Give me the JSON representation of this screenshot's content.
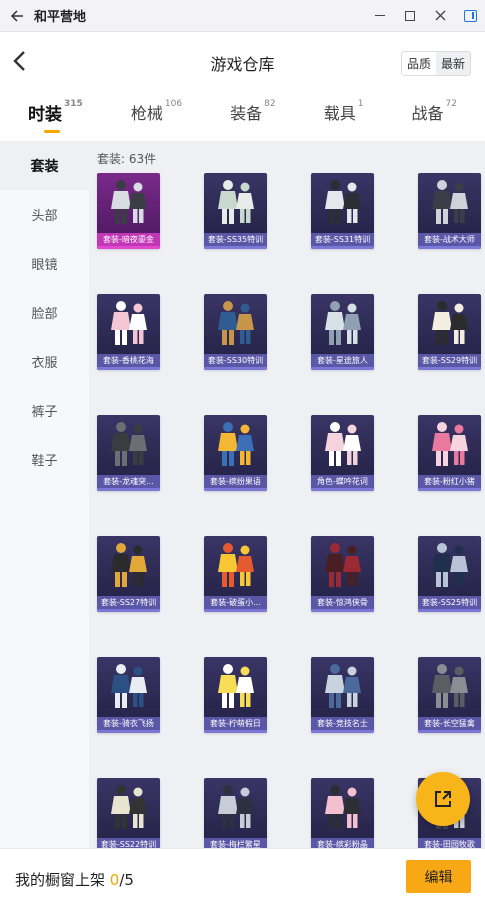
{
  "titlebar": {
    "back_icon": "arrow-left-icon",
    "app_title": "和平营地"
  },
  "header": {
    "title": "游戏仓库",
    "sort_options": [
      "品质",
      "最新"
    ]
  },
  "category_tabs": [
    {
      "label": "时装",
      "count": "315",
      "active": true
    },
    {
      "label": "枪械",
      "count": "106",
      "active": false
    },
    {
      "label": "装备",
      "count": "82",
      "active": false
    },
    {
      "label": "载具",
      "count": "1",
      "active": false
    },
    {
      "label": "战备",
      "count": "72",
      "active": false
    }
  ],
  "sidebar": {
    "items": [
      "套装",
      "头部",
      "眼镜",
      "脸部",
      "衣服",
      "裤子",
      "鞋子"
    ]
  },
  "content": {
    "count_label": "套装: 63件",
    "items": [
      {
        "label": "套装-暗夜鎏金",
        "rarity": "gold"
      },
      {
        "label": "套装-SS35特训",
        "rarity": "purple"
      },
      {
        "label": "套装-SS31特训",
        "rarity": "purple"
      },
      {
        "label": "套装-战术大师",
        "rarity": "purple"
      },
      {
        "label": "套装-香桃花海",
        "rarity": "purple"
      },
      {
        "label": "套装-SS30特训",
        "rarity": "purple"
      },
      {
        "label": "套装-星途旅人",
        "rarity": "purple"
      },
      {
        "label": "套装-SS29特训",
        "rarity": "purple"
      },
      {
        "label": "套装-龙魂突...",
        "rarity": "purple"
      },
      {
        "label": "套装-缤纷果语",
        "rarity": "purple"
      },
      {
        "label": "角色-蝶吟花词",
        "rarity": "purple"
      },
      {
        "label": "套装-粉红小猪",
        "rarity": "purple"
      },
      {
        "label": "套装-SS27特训",
        "rarity": "purple"
      },
      {
        "label": "套装-破蛋小...",
        "rarity": "purple"
      },
      {
        "label": "套装-惊鸿侠骨",
        "rarity": "purple"
      },
      {
        "label": "套装-SS25特训",
        "rarity": "purple"
      },
      {
        "label": "套装-骑衣飞扬",
        "rarity": "purple"
      },
      {
        "label": "套装-柠萌假日",
        "rarity": "purple"
      },
      {
        "label": "套装-竞技名士",
        "rarity": "purple"
      },
      {
        "label": "套装-长空猛禽",
        "rarity": "purple"
      },
      {
        "label": "套装-SS22特训",
        "rarity": "purple"
      },
      {
        "label": "套装-梅栏繁星",
        "rarity": "purple"
      },
      {
        "label": "套装-缤彩粉晶",
        "rarity": "purple"
      },
      {
        "label": "套装-田园牧歌",
        "rarity": "purple"
      }
    ]
  },
  "fab": {
    "icon": "share-external-icon"
  },
  "bottom": {
    "showcase_prefix": "我的橱窗上架 ",
    "showcase_count": "0",
    "showcase_total": "/5",
    "edit_label": "编辑"
  },
  "colors": {
    "accent": "#f7a400",
    "card_purple": "#5a57a6",
    "card_gold": "#c237b6"
  }
}
